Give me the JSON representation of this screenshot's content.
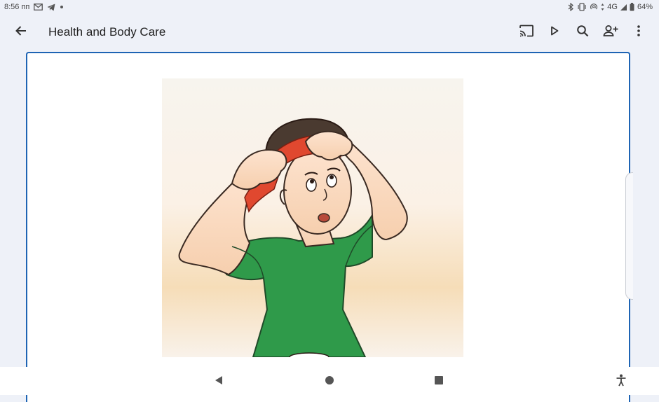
{
  "status_bar": {
    "time": "8:56 пп",
    "network": "4G",
    "battery": "64%"
  },
  "app_bar": {
    "title": "Health and Body Care",
    "icons": [
      "back-arrow-icon",
      "cast-icon",
      "play-icon",
      "search-icon",
      "add-person-icon",
      "more-vert-icon"
    ]
  },
  "content": {
    "illustration": "boy-holding-head-with-red-headband"
  },
  "nav_bar": {
    "icons": [
      "back-triangle-icon",
      "home-circle-icon",
      "recents-square-icon",
      "accessibility-icon"
    ]
  },
  "colors": {
    "background": "#eef1f8",
    "card_border": "#1e64b4",
    "shirt_green": "#2f9a4a",
    "headband_red": "#e0482f"
  }
}
